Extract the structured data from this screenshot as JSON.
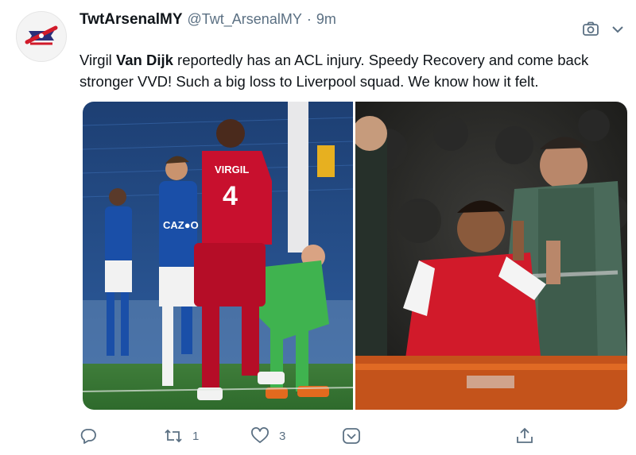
{
  "author": {
    "display_name": "TwtArsenalMY",
    "handle": "@Twt_ArsenalMY",
    "separator": "·",
    "time": "9m"
  },
  "tweet": {
    "text_part1": "Virgil ",
    "text_bold": "Van Dijk",
    "text_part2": " reportedly has an ACL injury. Speedy Recovery and come back stronger VVD! Such a big loss to Liverpool squad. We know how it felt."
  },
  "media": {
    "left_photo_shirt_name": "VIRGIL",
    "left_photo_shirt_number": "4"
  },
  "actions": {
    "retweet_count": "1",
    "like_count": "3"
  },
  "colors": {
    "text": "#0f1419",
    "muted": "#5b7083",
    "everton_blue": "#1a4fa8",
    "liverpool_red": "#c8102e",
    "keeper_green": "#3fb34f",
    "arsenal_red": "#d11a2a"
  },
  "icons": [
    "club-logo-icon",
    "camera-icon",
    "chevron-down-icon",
    "reply-icon",
    "retweet-icon",
    "like-icon",
    "bookmark-icon",
    "share-icon"
  ]
}
